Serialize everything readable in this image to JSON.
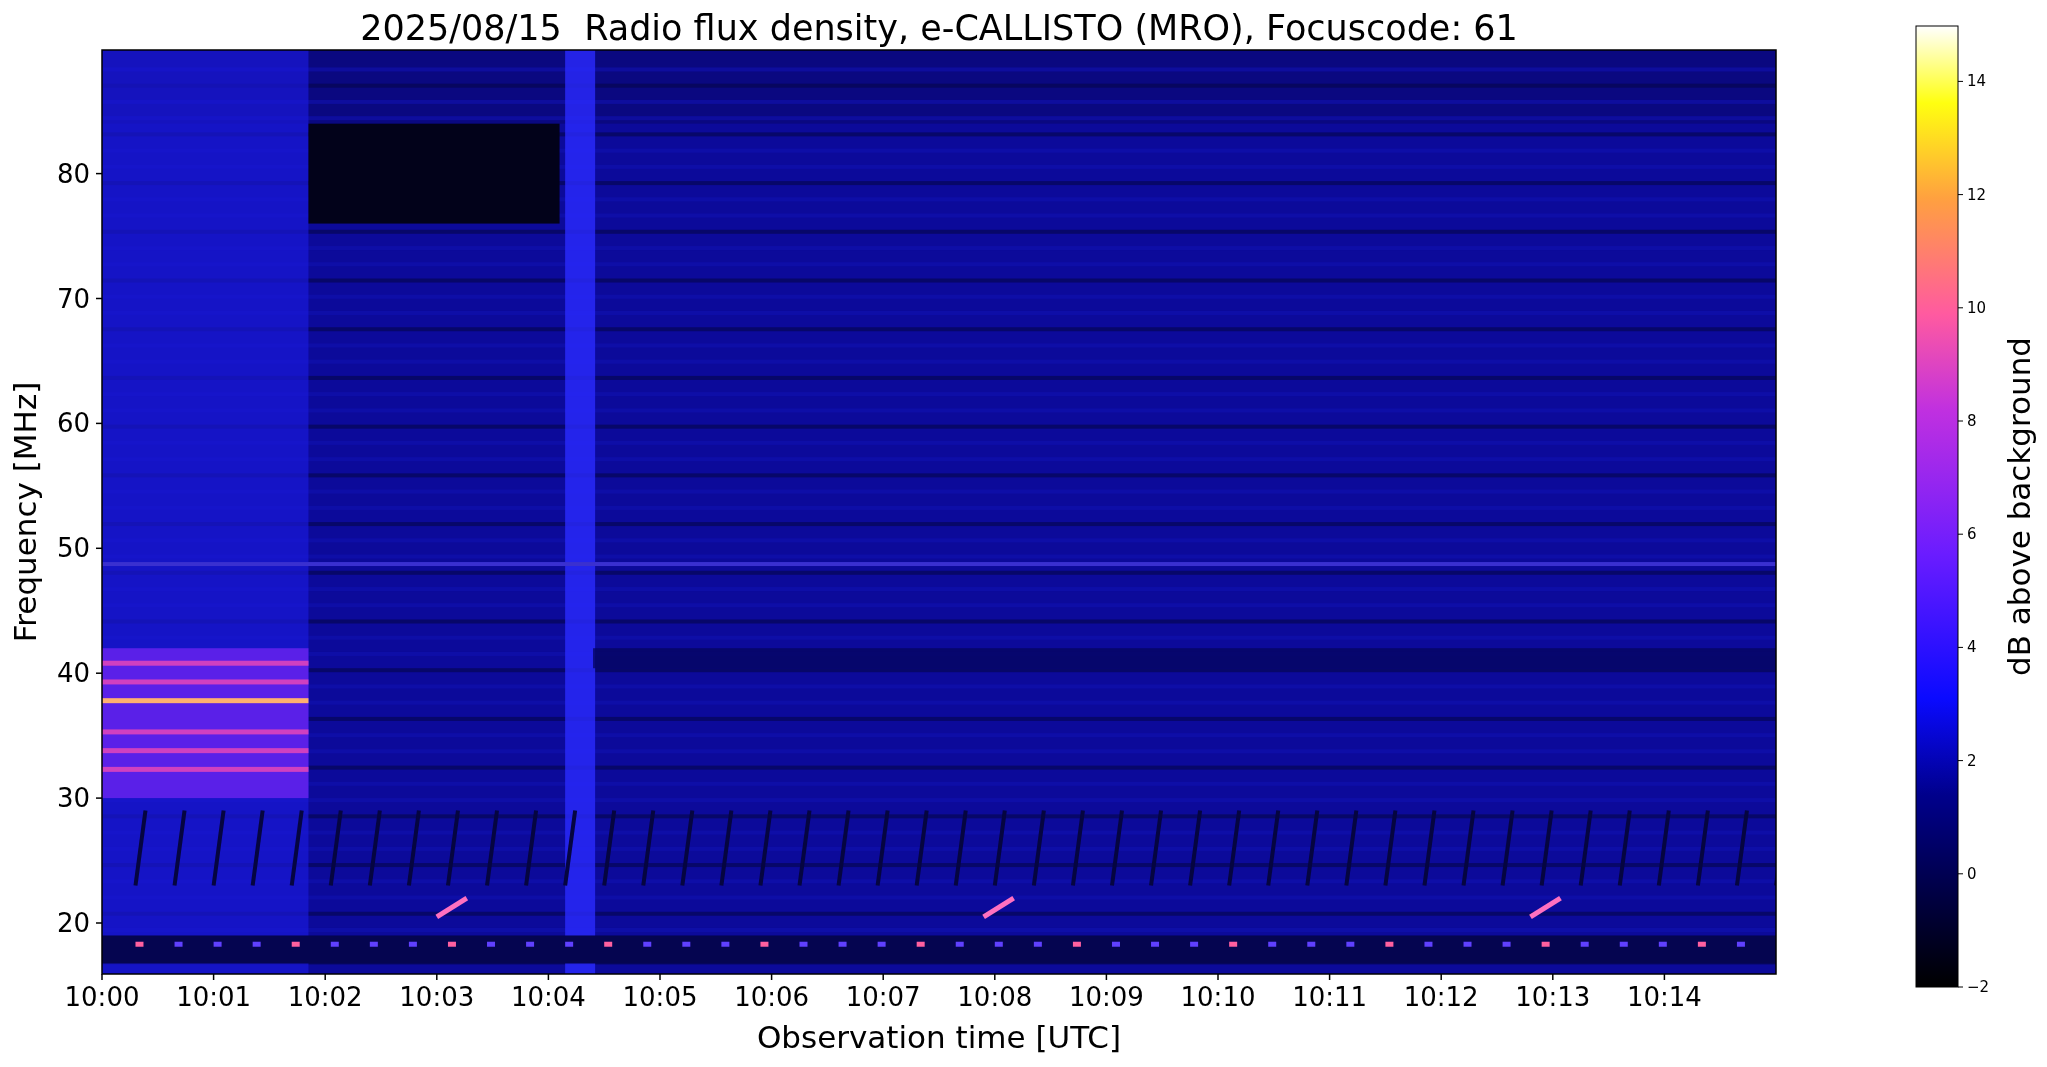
{
  "title": "2025/08/15  Radio flux density, e-CALLISTO (MRO), Focuscode: 61",
  "x_axis": {
    "label": "Observation time [UTC]",
    "ticks": [
      "10:00",
      "10:01",
      "10:02",
      "10:03",
      "10:04",
      "10:05",
      "10:06",
      "10:07",
      "10:08",
      "10:09",
      "10:10",
      "10:11",
      "10:12",
      "10:13",
      "10:14"
    ]
  },
  "y_axis": {
    "label": "Frequency [MHz]",
    "ticks": [
      "80",
      "70",
      "60",
      "50",
      "40",
      "30",
      "20"
    ]
  },
  "colorbar": {
    "label": "dB above background",
    "ticks": [
      "14",
      "12",
      "10",
      "8",
      "6",
      "4",
      "2",
      "0",
      "−2"
    ]
  }
}
